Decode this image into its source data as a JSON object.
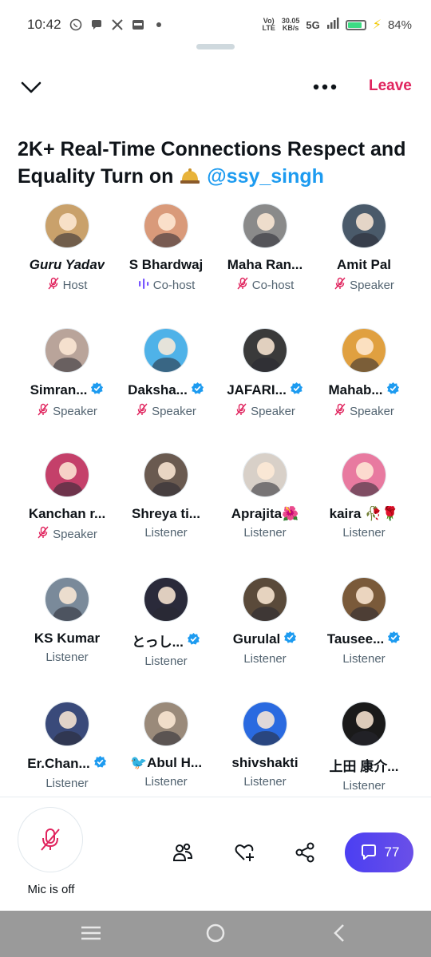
{
  "status_bar": {
    "time": "10:42",
    "network_speed_value": "30.05",
    "network_speed_unit": "KB/s",
    "network_type": "5G",
    "lte_label": "LTE",
    "battery_percent": "84%",
    "notification_icons": [
      "whatsapp-icon",
      "chat-icon",
      "x-icon",
      "paytm-icon",
      "dot-icon"
    ]
  },
  "header": {
    "leave_label": "Leave"
  },
  "space": {
    "title": "2K+ Real-Time Connections Respect and Equality Turn on",
    "host_handle": "@ssy_singh"
  },
  "participants": [
    {
      "name": "Guru Yadav",
      "role": "Host",
      "role_icon": "mic-off",
      "verified": false,
      "italic": true,
      "avatar_color": "#c9a16b"
    },
    {
      "name": "S Bhardwaj",
      "role": "Co-host",
      "role_icon": "speaking",
      "verified": false,
      "avatar_color": "#d99a7a"
    },
    {
      "name": "Maha Ran...",
      "role": "Co-host",
      "role_icon": "mic-off",
      "verified": false,
      "avatar_color": "#8a8a8a"
    },
    {
      "name": "Amit Pal",
      "role": "Speaker",
      "role_icon": "mic-off",
      "verified": false,
      "avatar_color": "#4a5a6a"
    },
    {
      "name": "Simran...",
      "role": "Speaker",
      "role_icon": "mic-off",
      "verified": true,
      "avatar_color": "#b9a49a"
    },
    {
      "name": "Daksha...",
      "role": "Speaker",
      "role_icon": "mic-off",
      "verified": true,
      "avatar_color": "#4fb2e8"
    },
    {
      "name": "JAFARI...",
      "role": "Speaker",
      "role_icon": "mic-off",
      "verified": true,
      "avatar_color": "#3a3a3a"
    },
    {
      "name": "Mahab...",
      "role": "Speaker",
      "role_icon": "mic-off",
      "verified": true,
      "avatar_color": "#e0a040"
    },
    {
      "name": "Kanchan r...",
      "role": "Speaker",
      "role_icon": "mic-off",
      "verified": false,
      "avatar_color": "#c4406a"
    },
    {
      "name": "Shreya ti...",
      "role": "Listener",
      "role_icon": "none",
      "verified": false,
      "avatar_color": "#6a5a50"
    },
    {
      "name": "Aprajita🌺",
      "role": "Listener",
      "role_icon": "none",
      "verified": false,
      "avatar_color": "#d8d0c8"
    },
    {
      "name": "kaira 🥀🌹",
      "role": "Listener",
      "role_icon": "none",
      "verified": false,
      "avatar_color": "#e87aa0"
    },
    {
      "name": "KS Kumar",
      "role": "Listener",
      "role_icon": "none",
      "verified": false,
      "avatar_color": "#7a8a9a"
    },
    {
      "name": "とっし...",
      "role": "Listener",
      "role_icon": "none",
      "verified": true,
      "avatar_color": "#2a2a3a"
    },
    {
      "name": "Gurulal",
      "role": "Listener",
      "role_icon": "none",
      "verified": true,
      "avatar_color": "#5a4a3a"
    },
    {
      "name": "Tausee...",
      "role": "Listener",
      "role_icon": "none",
      "verified": true,
      "avatar_color": "#7a5a3a"
    },
    {
      "name": "Er.Chan...",
      "role": "Listener",
      "role_icon": "none",
      "verified": true,
      "avatar_color": "#3a4a7a"
    },
    {
      "name": "🐦Abul H...",
      "role": "Listener",
      "role_icon": "none",
      "verified": false,
      "avatar_color": "#9a8a7a"
    },
    {
      "name": "shivshakti",
      "role": "Listener",
      "role_icon": "none",
      "verified": false,
      "avatar_color": "#2a6ae0"
    },
    {
      "name": "上田 康介...",
      "role": "Listener",
      "role_icon": "none",
      "verified": false,
      "avatar_color": "#1a1a1a"
    }
  ],
  "bottom_bar": {
    "mic_label": "Mic is off",
    "chat_count": "77"
  },
  "colors": {
    "accent": "#1d9bf0",
    "leave": "#e0245e",
    "mic_off": "#e0245e",
    "cohost_speaking": "#7856ff",
    "chat_button": "#5046f0"
  }
}
